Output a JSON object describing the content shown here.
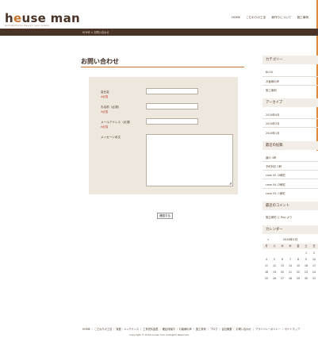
{
  "header": {
    "logo_text": "house man",
    "tagline": "architectural design your place",
    "nav": [
      "HOME",
      "こだわりの工法",
      "家作りについて",
      "施工事例"
    ]
  },
  "breadcrumb": {
    "home": "HOME",
    "sep": ">",
    "current": "お問い合わせ"
  },
  "main": {
    "title": "お問い合わせ",
    "form": {
      "company_label": "会社名",
      "company_req": "※必須",
      "name_label": "お名前（必須）",
      "name_req": "※必須",
      "email_label": "メールアドレス（必須）",
      "email_req": "※必須",
      "message_label": "メッセージ本文",
      "confirm_button": "確認する"
    }
  },
  "sidebar": {
    "categories_heading": "カテゴリー",
    "categories": [
      "BLOG",
      "お客様の声",
      "施工事例"
    ],
    "archive_heading": "アーカイブ",
    "archives": [
      "2016年4月",
      "2016年2月",
      "2016年1月"
    ],
    "recent_heading": "最近の投稿",
    "recent_posts": [
      "道の 1軒",
      "予約対応 1軒",
      "case 05. D様宅",
      "case 04. D様宅",
      "case 03. C様宅"
    ],
    "comments_heading": "最近のコメント",
    "comments": [
      "施主様宅 に Ray より"
    ],
    "calendar_heading": "カレンダー",
    "calendar": {
      "prev": "«",
      "month": "2016年1月",
      "weekdays": [
        "月",
        "火",
        "水",
        "木",
        "金",
        "土",
        "日"
      ],
      "weeks": [
        [
          "",
          "",
          "",
          "",
          "",
          "1",
          "2"
        ],
        [
          "4",
          "5",
          "6",
          "7",
          "8",
          "9",
          "10"
        ],
        [
          "11",
          "12",
          "13",
          "14",
          "15",
          "16",
          "17"
        ],
        [
          "18",
          "19",
          "20",
          "21",
          "22",
          "23",
          "24"
        ],
        [
          "25",
          "26",
          "27",
          "28",
          "29",
          "30",
          "31"
        ]
      ]
    }
  },
  "footer": {
    "links": "HOME ｜ こだわりの工法 ｜ 家庭・メンテナンス ｜ 工事完料金表 ｜ 確定判保内 ｜ お客様の声 ｜ 施工事例 ｜ ブログ ｜ 会社概要 ｜ お問い合わせ ｜ プライバシーポリシー ｜ サイトマップ",
    "copyright": "Copyright © 2016 house man All Rights Reserved"
  },
  "colors": {
    "brown": "#4a3428",
    "accent": "#c8762f",
    "panel": "#ede7dd"
  }
}
